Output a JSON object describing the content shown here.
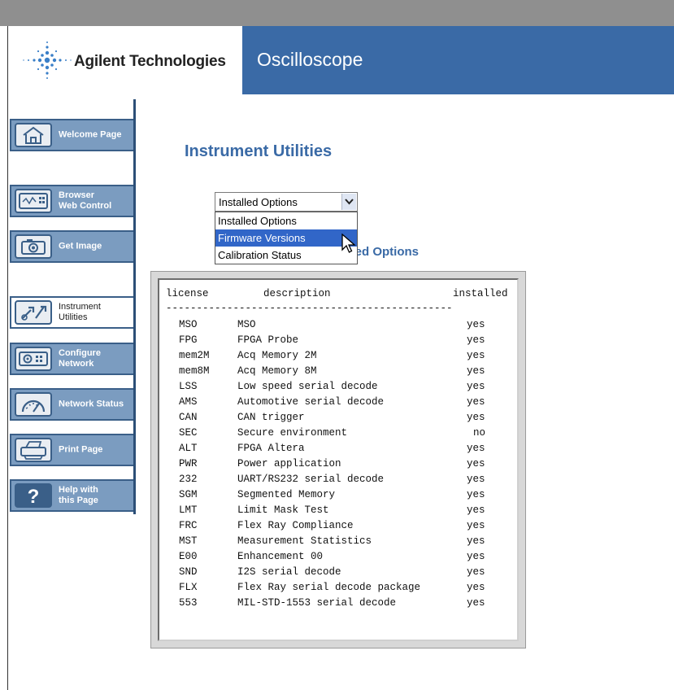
{
  "header": {
    "company": "Agilent Technologies",
    "product": "Oscilloscope"
  },
  "sidebar": {
    "items": [
      {
        "label_line1": "Welcome Page",
        "label_line2": "",
        "icon": "house-icon",
        "active": false
      },
      {
        "label_line1": "Browser",
        "label_line2": "Web Control",
        "icon": "scope-panel-icon",
        "active": false
      },
      {
        "label_line1": "Get Image",
        "label_line2": "",
        "icon": "camera-icon",
        "active": false
      },
      {
        "label_line1": "Instrument",
        "label_line2": "Utilities",
        "icon": "tools-icon",
        "active": true
      },
      {
        "label_line1": "Configure",
        "label_line2": "Network",
        "icon": "network-config-icon",
        "active": false
      },
      {
        "label_line1": "Network Status",
        "label_line2": "",
        "icon": "gauge-icon",
        "active": false
      },
      {
        "label_line1": "Print Page",
        "label_line2": "",
        "icon": "printer-icon",
        "active": false
      },
      {
        "label_line1": "Help with",
        "label_line2": "this Page",
        "icon": "help-icon",
        "active": false
      }
    ]
  },
  "main": {
    "title": "Instrument Utilities",
    "select": {
      "value": "Installed Options",
      "options": [
        "Installed Options",
        "Firmware Versions",
        "Calibration Status"
      ],
      "highlighted": "Firmware Versions"
    },
    "section_label": "alled Options",
    "table": {
      "headers": {
        "license": "license",
        "description": "description",
        "installed": "installed"
      },
      "rule": "-----------------------------------------------",
      "rows": [
        {
          "license": "MSO",
          "description": "MSO",
          "installed": "yes"
        },
        {
          "license": "FPG",
          "description": "FPGA Probe",
          "installed": "yes"
        },
        {
          "license": "mem2M",
          "description": "Acq Memory 2M",
          "installed": "yes"
        },
        {
          "license": "mem8M",
          "description": "Acq Memory 8M",
          "installed": "yes"
        },
        {
          "license": "LSS",
          "description": "Low speed serial decode",
          "installed": "yes"
        },
        {
          "license": "AMS",
          "description": "Automotive serial decode",
          "installed": "yes"
        },
        {
          "license": "CAN",
          "description": "CAN trigger",
          "installed": "yes"
        },
        {
          "license": "SEC",
          "description": "Secure environment",
          "installed": "no"
        },
        {
          "license": "ALT",
          "description": "FPGA Altera",
          "installed": "yes"
        },
        {
          "license": "PWR",
          "description": "Power application",
          "installed": "yes"
        },
        {
          "license": "232",
          "description": "UART/RS232 serial decode",
          "installed": "yes"
        },
        {
          "license": "SGM",
          "description": "Segmented Memory",
          "installed": "yes"
        },
        {
          "license": "LMT",
          "description": "Limit Mask Test",
          "installed": "yes"
        },
        {
          "license": "FRC",
          "description": "Flex Ray Compliance",
          "installed": "yes"
        },
        {
          "license": "MST",
          "description": "Measurement Statistics",
          "installed": "yes"
        },
        {
          "license": "E00",
          "description": "Enhancement 00",
          "installed": "yes"
        },
        {
          "license": "SND",
          "description": "I2S serial decode",
          "installed": "yes"
        },
        {
          "license": "FLX",
          "description": "Flex Ray serial decode package",
          "installed": "yes"
        },
        {
          "license": "553",
          "description": "MIL-STD-1553 serial decode",
          "installed": "yes"
        }
      ]
    }
  }
}
